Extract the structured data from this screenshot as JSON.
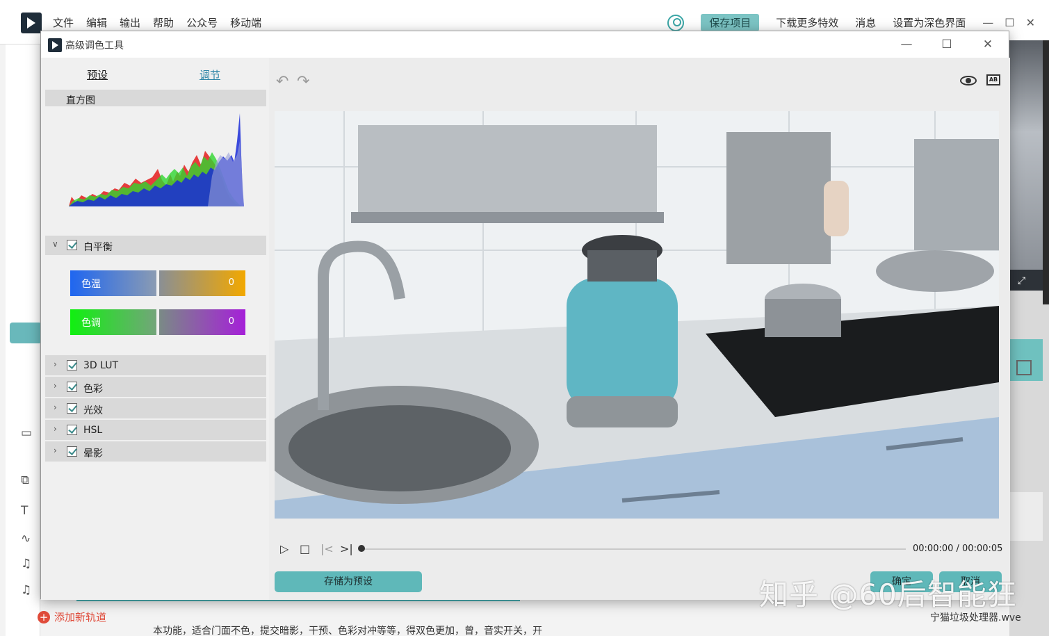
{
  "app": {
    "menu": [
      "文件",
      "编辑",
      "输出",
      "帮助",
      "公众号",
      "移动端"
    ],
    "save_project": "保存项目",
    "download_effects": "下载更多特效",
    "messages": "消息",
    "dark_theme": "设置为深色界面",
    "add_track": "添加新轨道",
    "bottom_caption": "本功能，适合门面不色，提交暗影，干预、色彩对冲等等，得双色更加，曾，音实开关，开",
    "filename": "宁猫垃圾处理器.wve",
    "watermark": "知乎 @60后智能狂"
  },
  "dialog": {
    "title": "高级调色工具",
    "tabs": {
      "preset": "预设",
      "adjust": "调节"
    },
    "histogram_label": "直方图",
    "white_balance": {
      "label": "白平衡",
      "temp_label": "色温",
      "temp_value": "0",
      "tint_label": "色调",
      "tint_value": "0"
    },
    "sections": [
      "3D LUT",
      "色彩",
      "光效",
      "HSL",
      "晕影"
    ],
    "timecode": "00:00:00 / 00:00:05",
    "progress": 0.0,
    "save_preset": "存储为预设",
    "ok": "确定",
    "cancel": "取消"
  }
}
